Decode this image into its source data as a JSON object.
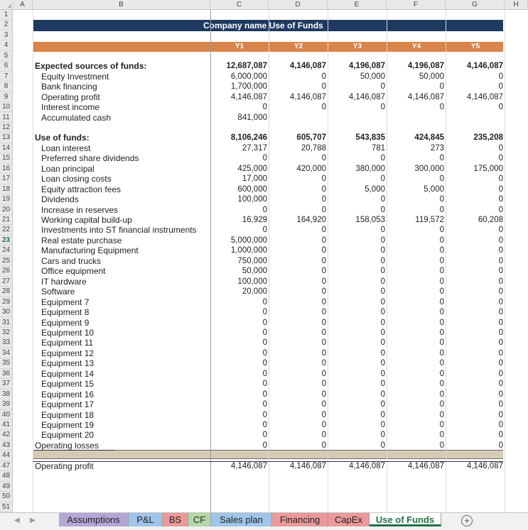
{
  "columns": [
    "A",
    "B",
    "C",
    "D",
    "E",
    "F",
    "G",
    "H"
  ],
  "rows": [
    "1",
    "2",
    "3",
    "4",
    "5",
    "6",
    "7",
    "8",
    "9",
    "10",
    "11",
    "12",
    "13",
    "14",
    "15",
    "16",
    "17",
    "18",
    "19",
    "20",
    "21",
    "22",
    "23",
    "24",
    "25",
    "26",
    "27",
    "28",
    "29",
    "30",
    "31",
    "32",
    "33",
    "34",
    "35",
    "36",
    "37",
    "38",
    "39",
    "40",
    "41",
    "42",
    "43",
    "44",
    "47",
    "48",
    "49",
    "50",
    "51"
  ],
  "selected_row": "23",
  "title": "Company name Use of Funds",
  "years": [
    "Y1",
    "Y2",
    "Y3",
    "Y4",
    "Y5"
  ],
  "sources": {
    "header": {
      "label": "Expected sources of funds:",
      "values": [
        "12,687,087",
        "4,146,087",
        "4,196,087",
        "4,196,087",
        "4,146,087"
      ]
    },
    "items": [
      {
        "label": "Equity Investment",
        "values": [
          "6,000,000",
          "0",
          "50,000",
          "50,000",
          "0"
        ]
      },
      {
        "label": "Bank financing",
        "values": [
          "1,700,000",
          "0",
          "0",
          "0",
          "0"
        ]
      },
      {
        "label": "Operating profit",
        "values": [
          "4,146,087",
          "4,146,087",
          "4,146,087",
          "4,146,087",
          "4,146,087"
        ]
      },
      {
        "label": "Interest income",
        "values": [
          "0",
          "0",
          "0",
          "0",
          "0"
        ]
      },
      {
        "label": "Accumulated cash",
        "values": [
          "841,000",
          "",
          "",
          "",
          ""
        ]
      }
    ]
  },
  "uses": {
    "header": {
      "label": "Use of funds:",
      "values": [
        "8,106,246",
        "605,707",
        "543,835",
        "424,845",
        "235,208"
      ]
    },
    "items": [
      {
        "label": "Loan interest",
        "values": [
          "27,317",
          "20,788",
          "781",
          "273",
          "0"
        ]
      },
      {
        "label": "Preferred share dividends",
        "values": [
          "0",
          "0",
          "0",
          "0",
          "0"
        ]
      },
      {
        "label": "Loan principal",
        "values": [
          "425,000",
          "420,000",
          "380,000",
          "300,000",
          "175,000"
        ]
      },
      {
        "label": "Loan closing costs",
        "values": [
          "17,000",
          "0",
          "0",
          "0",
          "0"
        ]
      },
      {
        "label": "Equity attraction fees",
        "values": [
          "600,000",
          "0",
          "5,000",
          "5,000",
          "0"
        ]
      },
      {
        "label": "Dividends",
        "values": [
          "100,000",
          "0",
          "0",
          "0",
          "0"
        ]
      },
      {
        "label": "Increase in reserves",
        "values": [
          "0",
          "0",
          "0",
          "0",
          "0"
        ]
      },
      {
        "label": "Working capital build-up",
        "values": [
          "16,929",
          "164,920",
          "158,053",
          "119,572",
          "60,208"
        ]
      },
      {
        "label": "Investments into ST financial instruments",
        "values": [
          "0",
          "0",
          "0",
          "0",
          "0"
        ]
      },
      {
        "label": "Real estate purchase",
        "values": [
          "5,000,000",
          "0",
          "0",
          "0",
          "0"
        ]
      },
      {
        "label": "Manufacturing Equipment",
        "values": [
          "1,000,000",
          "0",
          "0",
          "0",
          "0"
        ]
      },
      {
        "label": "Cars and trucks",
        "values": [
          "750,000",
          "0",
          "0",
          "0",
          "0"
        ]
      },
      {
        "label": "Office equipment",
        "values": [
          "50,000",
          "0",
          "0",
          "0",
          "0"
        ]
      },
      {
        "label": "IT hardware",
        "values": [
          "100,000",
          "0",
          "0",
          "0",
          "0"
        ]
      },
      {
        "label": "Software",
        "values": [
          "20,000",
          "0",
          "0",
          "0",
          "0"
        ]
      },
      {
        "label": "Equipment 7",
        "values": [
          "0",
          "0",
          "0",
          "0",
          "0"
        ]
      },
      {
        "label": "Equipment 8",
        "values": [
          "0",
          "0",
          "0",
          "0",
          "0"
        ]
      },
      {
        "label": "Equipment 9",
        "values": [
          "0",
          "0",
          "0",
          "0",
          "0"
        ]
      },
      {
        "label": "Equipment 10",
        "values": [
          "0",
          "0",
          "0",
          "0",
          "0"
        ]
      },
      {
        "label": "Equipment 11",
        "values": [
          "0",
          "0",
          "0",
          "0",
          "0"
        ]
      },
      {
        "label": "Equipment 12",
        "values": [
          "0",
          "0",
          "0",
          "0",
          "0"
        ]
      },
      {
        "label": "Equipment 13",
        "values": [
          "0",
          "0",
          "0",
          "0",
          "0"
        ]
      },
      {
        "label": "Equipment 14",
        "values": [
          "0",
          "0",
          "0",
          "0",
          "0"
        ]
      },
      {
        "label": "Equipment 15",
        "values": [
          "0",
          "0",
          "0",
          "0",
          "0"
        ]
      },
      {
        "label": "Equipment 16",
        "values": [
          "0",
          "0",
          "0",
          "0",
          "0"
        ]
      },
      {
        "label": "Equipment 17",
        "values": [
          "0",
          "0",
          "0",
          "0",
          "0"
        ]
      },
      {
        "label": "Equipment 18",
        "values": [
          "0",
          "0",
          "0",
          "0",
          "0"
        ]
      },
      {
        "label": "Equipment 19",
        "values": [
          "0",
          "0",
          "0",
          "0",
          "0"
        ]
      },
      {
        "label": "Equipment 20",
        "values": [
          "0",
          "0",
          "0",
          "0",
          "0"
        ]
      },
      {
        "label": "Operating losses",
        "values": [
          "0",
          "0",
          "0",
          "0",
          "0"
        ]
      }
    ]
  },
  "footer": {
    "label": "Operating profit",
    "values": [
      "4,146,087",
      "4,146,087",
      "4,146,087",
      "4,146,087",
      "4,146,087"
    ]
  },
  "sheet_tabs": [
    {
      "label": "Assumptions",
      "color": "#b4a7d6"
    },
    {
      "label": "P&L",
      "color": "#9fc5e8"
    },
    {
      "label": "BS",
      "color": "#ea9999"
    },
    {
      "label": "CF",
      "color": "#b6d7a8"
    },
    {
      "label": "Sales plan",
      "color": "#9fc5e8"
    },
    {
      "label": "Financing",
      "color": "#ea9999"
    },
    {
      "label": "CapEx",
      "color": "#ea9999"
    },
    {
      "label": "Use of Funds",
      "color": "#ffffff",
      "active": true
    }
  ],
  "add_sheet_icon": "+",
  "colors": {
    "title_bg": "#1f3a60",
    "header_bg": "#d9844a",
    "separator_bg": "#d5cbb4",
    "active_tab": "#217346"
  }
}
